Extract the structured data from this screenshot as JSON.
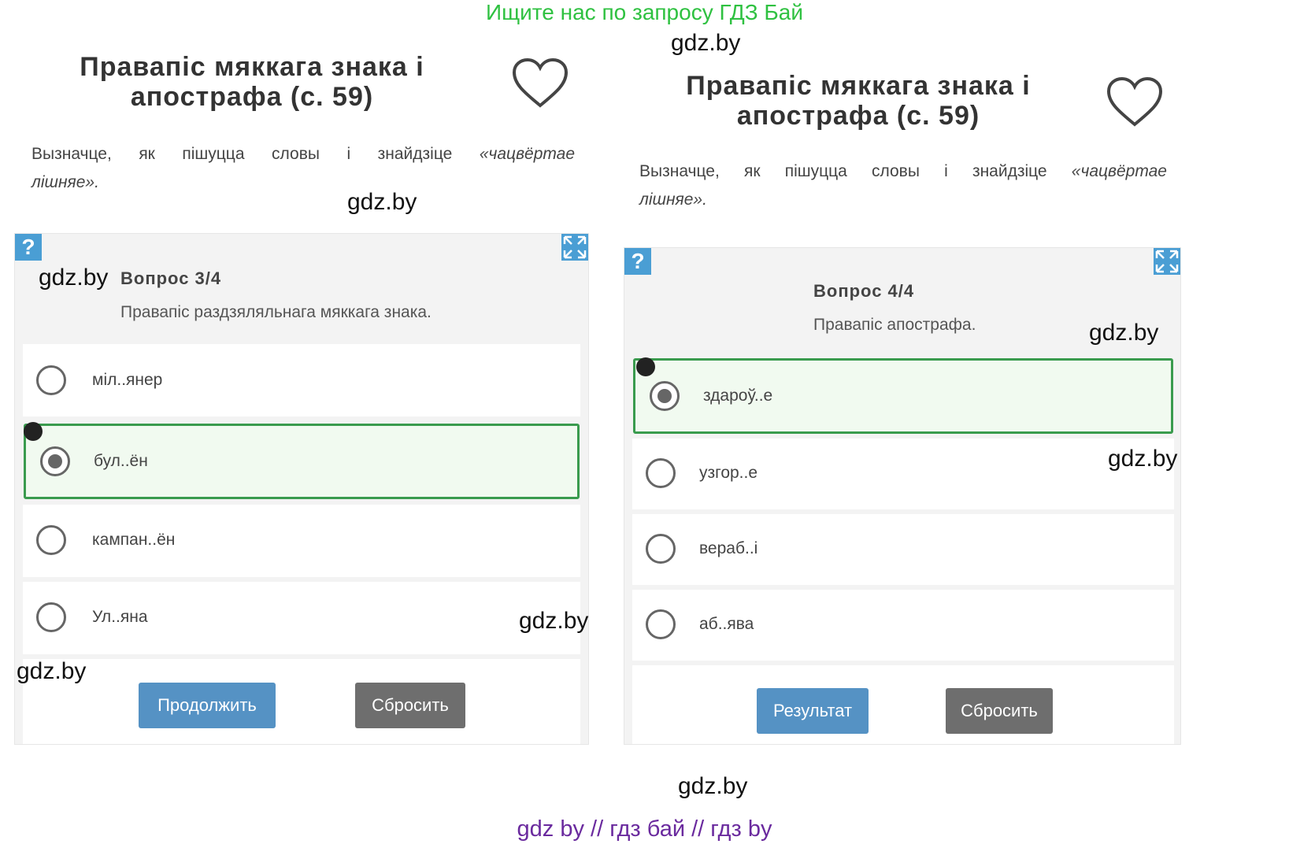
{
  "banner": "Ищите нас по запросу ГДЗ Бай",
  "watermark": "gdz.by",
  "footer": "gdz by  //  гдз бай  //  гдз by",
  "icons": {
    "help": "question-icon",
    "fullscreen": "expand-icon",
    "favorite": "heart-icon"
  },
  "colors": {
    "accent_blue": "#4a9ed4",
    "selected_border": "#3a9b4e",
    "banner_green": "#2fc141",
    "footer_purple": "#6a2a9e"
  },
  "left": {
    "title_line1": "Правапіс мяккага знака і",
    "title_line2": "апострафа (с. 59)",
    "instr_words": [
      "Вызначце,",
      "як",
      "пішуцца",
      "словы",
      "і",
      "знайдзіце"
    ],
    "instr_italic1": "«чацвёртае",
    "instr_italic2": "лішняе».",
    "help_label": "?",
    "question_number": "Вопрос 3/4",
    "question_text": "Правапіс раздзяляльнага мяккага знака.",
    "options": [
      {
        "label": "міл..янер",
        "selected": false
      },
      {
        "label": "бул..ён",
        "selected": true
      },
      {
        "label": "кампан..ён",
        "selected": false
      },
      {
        "label": "Ул..яна",
        "selected": false
      }
    ],
    "btn_primary": "Продолжить",
    "btn_reset": "Сбросить"
  },
  "right": {
    "title_line1": "Правапіс мяккага знака і",
    "title_line2": "апострафа (с. 59)",
    "instr_words": [
      "Вызначце,",
      "як",
      "пішуцца",
      "словы",
      "і",
      "знайдзіце"
    ],
    "instr_italic1": "«чацвёртае",
    "instr_italic2": "лішняе».",
    "help_label": "?",
    "question_number": "Вопрос 4/4",
    "question_text": "Правапіс апострафа.",
    "options": [
      {
        "label": "здароў..е",
        "selected": true
      },
      {
        "label": "узгор..е",
        "selected": false
      },
      {
        "label": "вераб..і",
        "selected": false
      },
      {
        "label": "аб..ява",
        "selected": false
      }
    ],
    "btn_primary": "Результат",
    "btn_reset": "Сбросить"
  }
}
